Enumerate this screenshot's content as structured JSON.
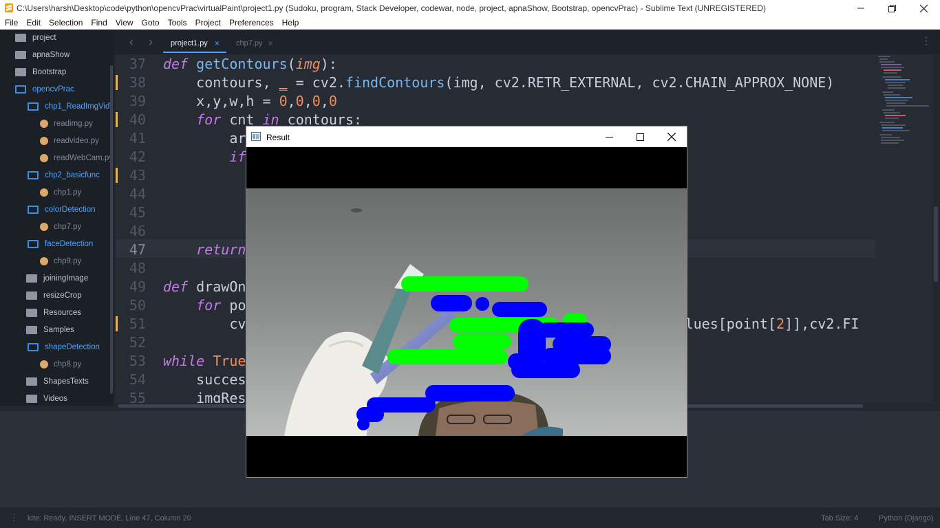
{
  "window": {
    "title": "C:\\Users\\harsh\\Desktop\\code\\python\\opencvPrac\\virtualPaint\\project1.py (Sudoku, program, Stack Developer, codewar, node, project, apnaShow, Bootstrap, opencvPrac) - Sublime Text (UNREGISTERED)",
    "controls": [
      "minimize",
      "restore",
      "close"
    ]
  },
  "menu": [
    "File",
    "Edit",
    "Selection",
    "Find",
    "View",
    "Goto",
    "Tools",
    "Project",
    "Preferences",
    "Help"
  ],
  "sidebar": {
    "items": [
      {
        "label": "project",
        "kind": "folder",
        "open": false
      },
      {
        "label": "apnaShow",
        "kind": "folder",
        "open": false
      },
      {
        "label": "Bootstrap",
        "kind": "folder",
        "open": false
      },
      {
        "label": "opencvPrac",
        "kind": "folder",
        "open": true
      },
      {
        "label": "chp1_ReadImgVid\\",
        "kind": "folder",
        "open": true
      },
      {
        "label": "readimg.py",
        "kind": "file"
      },
      {
        "label": "readvideo.py",
        "kind": "file"
      },
      {
        "label": "readWebCam.py",
        "kind": "file"
      },
      {
        "label": "chp2_basicfunc",
        "kind": "folder",
        "open": true
      },
      {
        "label": "chp1.py",
        "kind": "file"
      },
      {
        "label": "colorDetection",
        "kind": "folder",
        "open": true
      },
      {
        "label": "chp7.py",
        "kind": "file"
      },
      {
        "label": "faceDetection",
        "kind": "folder",
        "open": true
      },
      {
        "label": "chp9.py",
        "kind": "file"
      },
      {
        "label": "joiningImage",
        "kind": "folder",
        "open": false
      },
      {
        "label": "resizeCrop",
        "kind": "folder",
        "open": false
      },
      {
        "label": "Resources",
        "kind": "folder",
        "open": false
      },
      {
        "label": "Samples",
        "kind": "folder",
        "open": false
      },
      {
        "label": "shapeDetection",
        "kind": "folder",
        "open": true
      },
      {
        "label": "chp8.py",
        "kind": "file"
      },
      {
        "label": "ShapesTexts",
        "kind": "folder",
        "open": false
      },
      {
        "label": "Videos",
        "kind": "folder",
        "open": false
      }
    ]
  },
  "tabs": [
    {
      "label": "project1.py",
      "active": true
    },
    {
      "label": "chp7.py",
      "active": false
    }
  ],
  "editor": {
    "current_line": "47",
    "lines": [
      {
        "n": "37",
        "text": "def getContours(img):"
      },
      {
        "n": "38",
        "text": "    contours, _ = cv2.findContours(img, cv2.RETR_EXTERNAL, cv2.CHAIN_APPROX_NONE)"
      },
      {
        "n": "39",
        "text": "    x,y,w,h = 0,0,0,0"
      },
      {
        "n": "40",
        "text": "    for cnt in contours:"
      },
      {
        "n": "41",
        "text": "        ar"
      },
      {
        "n": "42",
        "text": "        if"
      },
      {
        "n": "43",
        "text": ""
      },
      {
        "n": "44",
        "text": ""
      },
      {
        "n": "45",
        "text": ""
      },
      {
        "n": "46",
        "text": ""
      },
      {
        "n": "47",
        "text": "    return"
      },
      {
        "n": "48",
        "text": ""
      },
      {
        "n": "49",
        "text": "def drawOn"
      },
      {
        "n": "50",
        "text": "    for po"
      },
      {
        "n": "51",
        "text": "        cv                                                    alues[point[2]],cv2.FI"
      },
      {
        "n": "52",
        "text": ""
      },
      {
        "n": "53",
        "text": "while True"
      },
      {
        "n": "54",
        "text": "    succes"
      },
      {
        "n": "55",
        "text": "    imgRes"
      }
    ]
  },
  "result_window": {
    "title": "Result",
    "controls": [
      "minimize",
      "maximize",
      "close"
    ]
  },
  "statusbar": {
    "left": "kite: Ready, INSERT MODE, Line 47, Column 20",
    "tab_size": "Tab Size: 4",
    "syntax": "Python (Django)"
  },
  "colors": {
    "folder_open": "#3a8ee6",
    "folder_closed": "#8f96a3",
    "python_icon": "#d9a86a",
    "paint_green": "#00ff00",
    "paint_blue": "#0000ff",
    "modified_marker": "#e5b75a"
  }
}
